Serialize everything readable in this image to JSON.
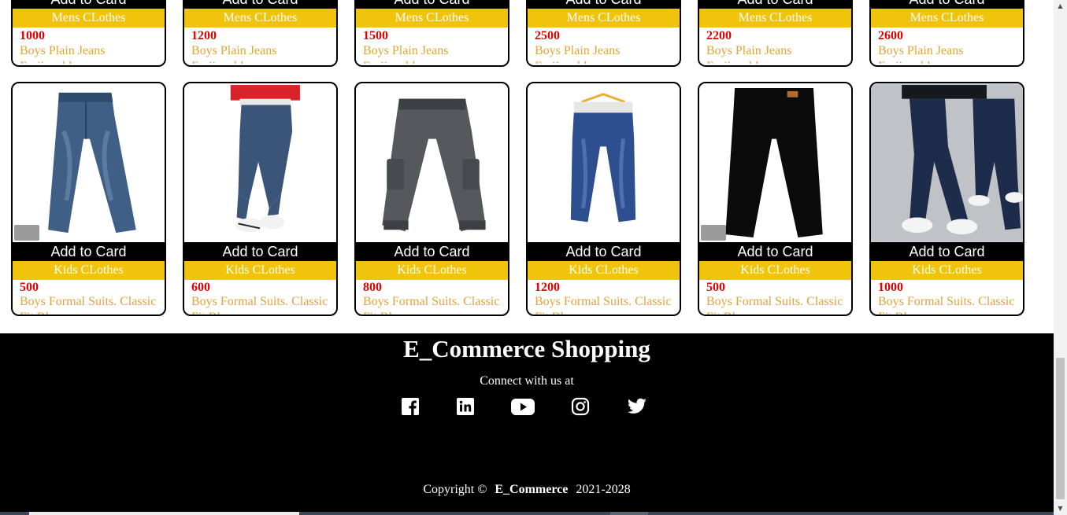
{
  "top_row": [
    {
      "add_label": "Add to Card",
      "category": "Mens CLothes",
      "price": "1000",
      "name": "Boys Plain Jeans Fasiionable"
    },
    {
      "add_label": "Add to Card",
      "category": "Mens CLothes",
      "price": "1200",
      "name": "Boys Plain Jeans Fasiionable"
    },
    {
      "add_label": "Add to Card",
      "category": "Mens CLothes",
      "price": "1500",
      "name": "Boys Plain Jeans Fasiionable"
    },
    {
      "add_label": "Add to Card",
      "category": "Mens CLothes",
      "price": "2500",
      "name": "Boys Plain Jeans Fasiionable"
    },
    {
      "add_label": "Add to Card",
      "category": "Mens CLothes",
      "price": "2200",
      "name": "Boys Plain Jeans Fasiionable"
    },
    {
      "add_label": "Add to Card",
      "category": "Mens CLothes",
      "price": "2600",
      "name": "Boys Plain Jeans Fasiionable"
    }
  ],
  "mid_row": [
    {
      "add_label": "Add to Card",
      "category": "Kids CLothes",
      "price": "500",
      "name": "Boys Formal Suits. Classic Fit Blazer",
      "image": "jeans-blue-icon"
    },
    {
      "add_label": "Add to Card",
      "category": "Kids CLothes",
      "price": "600",
      "name": "Boys Formal Suits. Classic Fit Blazer",
      "image": "kid-jeans-photo"
    },
    {
      "add_label": "Add to Card",
      "category": "Kids CLothes",
      "price": "800",
      "name": "Boys Formal Suits. Classic Fit Blazer",
      "image": "cargo-jeans-grey"
    },
    {
      "add_label": "Add to Card",
      "category": "Kids CLothes",
      "price": "1200",
      "name": "Boys Formal Suits. Classic Fit Blazer",
      "image": "jeans-hanger"
    },
    {
      "add_label": "Add to Card",
      "category": "Kids CLothes",
      "price": "500",
      "name": "Boys Formal Suits. Classic Fit Blazer",
      "image": "jeans-black"
    },
    {
      "add_label": "Add to Card",
      "category": "Kids CLothes",
      "price": "1000",
      "name": "Boys Formal Suits. Classic Fit Blazer",
      "image": "kid-jeans-street-photo"
    }
  ],
  "footer": {
    "brand": "E_Commerce Shopping",
    "connect": "Connect with us at",
    "socials": [
      "facebook-icon",
      "linkedin-icon",
      "youtube-icon",
      "instagram-icon",
      "twitter-icon"
    ],
    "copy_prefix": "Copyright ©",
    "copy_brand": "E_Commerce",
    "copy_years": "2021-2028"
  },
  "colors": {
    "category_bar": "#f0c40a",
    "price": "#e00000",
    "name": "#e0a43a",
    "footer_bg": "#000000"
  }
}
